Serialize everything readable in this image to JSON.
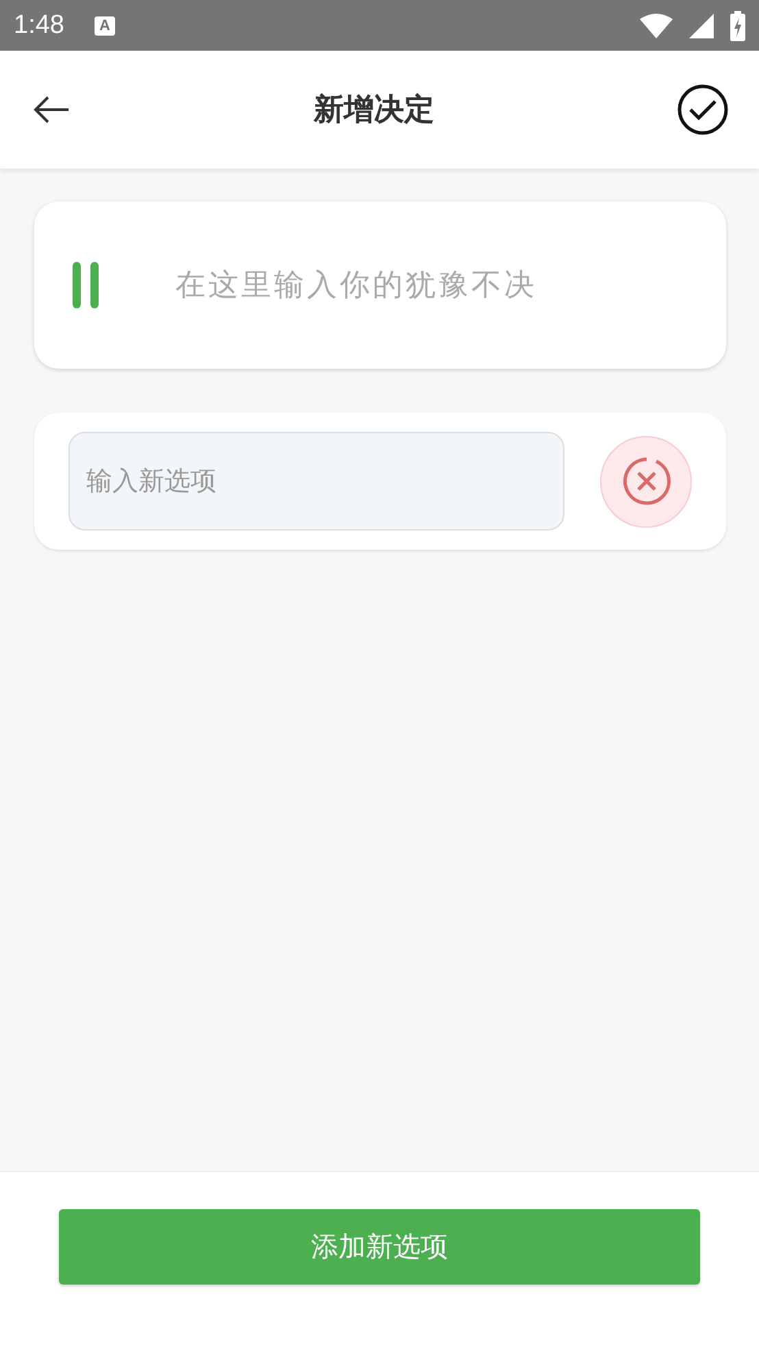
{
  "status_bar": {
    "time": "1:48",
    "notification_glyph": "A"
  },
  "header": {
    "title": "新增决定"
  },
  "question": {
    "placeholder": "在这里输入你的犹豫不决"
  },
  "options": [
    {
      "placeholder": "输入新选项"
    }
  ],
  "footer": {
    "add_button": "添加新选项"
  }
}
